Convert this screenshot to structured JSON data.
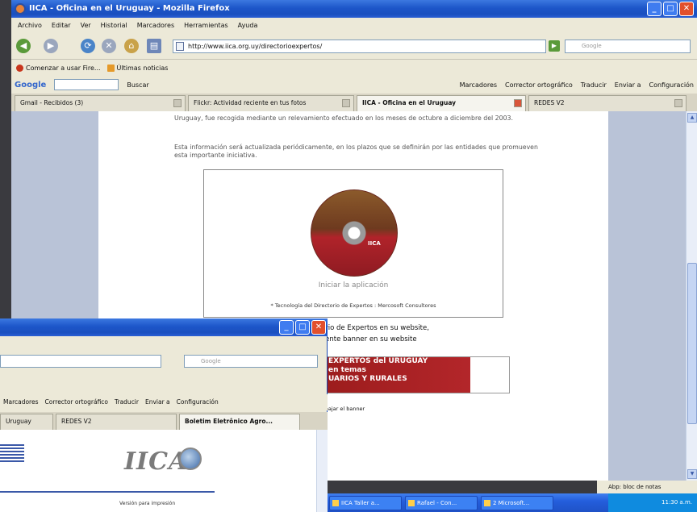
{
  "main_window": {
    "title": "IICA - Oficina en el Uruguay - Mozilla Firefox",
    "menu": [
      "Archivo",
      "Editar",
      "Ver",
      "Historial",
      "Marcadores",
      "Herramientas",
      "Ayuda"
    ],
    "url": "http://www.iica.org.uy/directorioexpertos/",
    "search_placeholder": "Google",
    "bookmarks": [
      "Comenzar a usar Fire...",
      "Últimas noticias"
    ],
    "google_toolbar": {
      "logo": "Google",
      "items": [
        "Buscar",
        "Marcadores",
        "Corrector ortográfico",
        "Traducir",
        "Enviar a",
        "Configuración"
      ]
    },
    "tabs": [
      {
        "label": "Gmail - Recibidos (3)"
      },
      {
        "label": "Flickr: Actividad reciente en tus fotos"
      },
      {
        "label": "IICA - Oficina en el Uruguay"
      },
      {
        "label": "REDES V2"
      }
    ],
    "content": {
      "para1": "Uruguay, fue recogida mediante un relevamiento efectuado en los meses de octubre a diciembre del 2003.",
      "para2": "Esta información será actualizada periódicamente, en los plazos que se definirán por las entidades que promueven esta importante iniciativa.",
      "cd_label": "IICA",
      "cd_caption": "Iniciar la aplicación",
      "cd_credit": "* Tecnología del Directorio de Expertos : Mercosoft Consultores",
      "invite_line1": "ctorio de Expertos en su website,",
      "invite_line2": "guiente banner en su website",
      "banner_line1": "EXPERTOS del URUGUAY",
      "banner_line2": "en temas",
      "banner_line3": "UARIOS Y RURALES",
      "banner_hint": "ara bajar el banner"
    },
    "status": "Abp: bloc de notas"
  },
  "taskbar": {
    "buttons": [
      "IICA Taller a...",
      "Rafael - Con...",
      "2 Microsoft..."
    ],
    "clock": "11:30 a.m."
  },
  "second_window": {
    "search_placeholder": "Google",
    "toolbar_items": [
      "Marcadores",
      "Corrector ortográfico",
      "Traducir",
      "Enviar a",
      "Configuración"
    ],
    "tabs": [
      "Uruguay",
      "REDES V2",
      "Boletim Eletrônico Agro..."
    ],
    "logo_text": "IICA",
    "print_link": "Versión para impresión"
  }
}
